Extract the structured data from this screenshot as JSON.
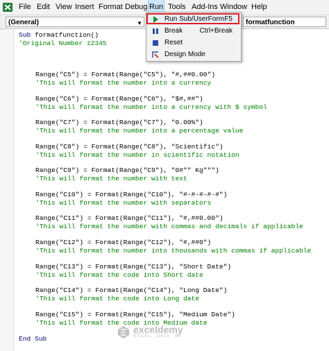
{
  "menubar": {
    "items": [
      "File",
      "Edit",
      "View",
      "Insert",
      "Format",
      "Debug",
      "Run",
      "Tools",
      "Add-Ins",
      "Window",
      "Help"
    ]
  },
  "dropdowns": {
    "object": "(General)",
    "procedure": "formatfunction"
  },
  "run_menu": {
    "items": [
      {
        "label": "Run Sub/UserForm",
        "shortcut": "F5",
        "icon": "play-icon"
      },
      {
        "label": "Break",
        "shortcut": "Ctrl+Break",
        "icon": "pause-icon"
      },
      {
        "label": "Reset",
        "shortcut": "",
        "icon": "stop-icon"
      },
      {
        "label": "Design Mode",
        "shortcut": "",
        "icon": "design-mode-icon"
      }
    ]
  },
  "code": {
    "sub_keyword": "Sub",
    "sub_name": " formatfunction()",
    "original_comment": "'Original Number 12345",
    "blocks": [
      {
        "range": "Range(\"C5\") = Format(Range(\"C5\"), \"#,##0.00\")",
        "comment": "'This will format the number into a currency"
      },
      {
        "range": "Range(\"C6\") = Format(Range(\"C6\"), \"$#,##\")",
        "comment": "'This will format the number into a currency with $ symbol"
      },
      {
        "range": "Range(\"C7\") = Format(Range(\"C7\"), \"0.00%\")",
        "comment": "'This will format the number into a percentage value"
      },
      {
        "range": "Range(\"C8\") = Format(Range(\"C8\"), \"Scientific\")",
        "comment": "'This will format the number in scientific notation"
      },
      {
        "range": "Range(\"C9\") = Format(Range(\"C9\"), \"0#\"\" Kg\"\"\")",
        "comment": "'This will format the number with text"
      },
      {
        "range": "Range(\"C10\") = Format(Range(\"C10\"), \"#-#-#-#-#\")",
        "comment": "'This will format the number with separators"
      },
      {
        "range": "Range(\"C11\") = Format(Range(\"C11\"), \"#,##0.00\")",
        "comment": "'This will format the number with commas and decimals if applicable"
      },
      {
        "range": "Range(\"C12\") = Format(Range(\"C12\"), \"#,##0\")",
        "comment": "'This will format the number into thousands with commas if applicable"
      },
      {
        "range": "Range(\"C13\") = Format(Range(\"C13\"), \"Short Date\")",
        "comment": "'This will format the code into Short date"
      },
      {
        "range": "Range(\"C14\") = Format(Range(\"C14\"), \"Long Date\")",
        "comment": "'This will format the code into Long date"
      },
      {
        "range": "Range(\"C15\") = Format(Range(\"C15\"), \"Medium Date\")",
        "comment": "'This will format the code into Medium date"
      }
    ],
    "end_sub": "End Sub"
  },
  "watermark": {
    "name": "exceldemy",
    "tagline": "EXCEL · DATA · BI"
  },
  "colors": {
    "keyword": "#00007f",
    "comment": "#008000",
    "menu_highlight_border": "#e02020"
  }
}
